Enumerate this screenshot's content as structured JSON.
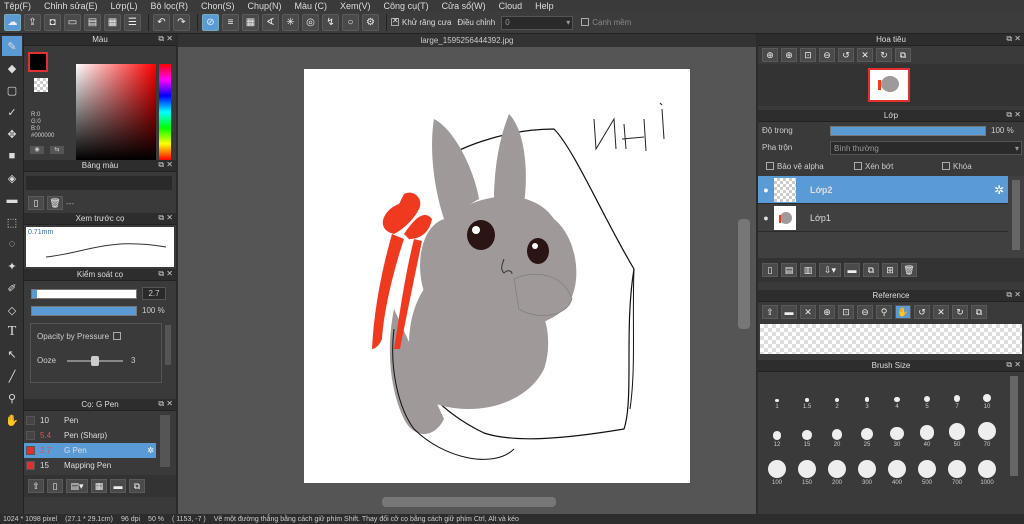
{
  "menu": [
    "Tệp(F)",
    "Chỉnh sửa(E)",
    "Lớp(L)",
    "Bộ lọc(R)",
    "Chọn(S)",
    "Chụp(N)",
    "Màu (C)",
    "Xem(V)",
    "Công cụ(T)",
    "Cửa sổ(W)",
    "Cloud",
    "Help"
  ],
  "toolbar": {
    "antialias_label": "Khử răng cưa",
    "adjust_label": "Điều chỉnh",
    "adjust_value": "0",
    "smooth_label": "Cạnh mềm"
  },
  "color_panel": {
    "title": "Màu",
    "r": "R:0",
    "g": "G:0",
    "b": "B:0",
    "hex": "#000000"
  },
  "palette_panel": {
    "title": "Bảng màu",
    "dash": "---"
  },
  "preview_panel": {
    "title": "Xem trước cọ",
    "size": "0.71mm"
  },
  "control_panel": {
    "title": "Kiểm soát cọ",
    "size_value": "2.7",
    "size_fraction": 0.05,
    "opacity_value": "100 %",
    "opacity_fraction": 1.0,
    "opacity_pressure": "Opacity by Pressure",
    "ooze_label": "Ooze",
    "ooze_value": "3",
    "ooze_fraction": 0.5
  },
  "brush_panel": {
    "title": "Cọ: G Pen",
    "items": [
      {
        "size": "10",
        "name": "Pen",
        "color": "#444444",
        "active": false
      },
      {
        "size": "5.4",
        "name": "Pen (Sharp)",
        "color": "#444444",
        "active": false
      },
      {
        "size": "2.7",
        "name": "G Pen",
        "color": "#e03030",
        "active": true
      },
      {
        "size": "15",
        "name": "Mapping Pen",
        "color": "#e03030",
        "active": false
      }
    ]
  },
  "document": {
    "tab": "large_1595256444392.jpg",
    "text_on_canvas": "NHi"
  },
  "navigator": {
    "title": "Hoa tiêu"
  },
  "layer_panel": {
    "title": "Lớp",
    "opacity_label": "Độ trong",
    "opacity_value": "100 %",
    "opacity_fraction": 1.0,
    "blend_label": "Pha trộn",
    "blend_value": "Bình thường",
    "protect_alpha": "Bảo vệ alpha",
    "clipping": "Xén bớt",
    "lock": "Khóa",
    "layers": [
      {
        "name": "Lớp2",
        "active": true
      },
      {
        "name": "Lớp1",
        "active": false
      }
    ]
  },
  "reference_panel": {
    "title": "Reference"
  },
  "brush_size_panel": {
    "title": "Brush Size",
    "sizes": [
      "1",
      "1.5",
      "2",
      "3",
      "4",
      "5",
      "7",
      "10",
      "12",
      "15",
      "20",
      "25",
      "30",
      "40",
      "50",
      "70",
      "100",
      "150",
      "200",
      "300",
      "400",
      "500",
      "700",
      "1000"
    ]
  },
  "status": {
    "dimensions": "1024 * 1098 pixel",
    "physical": "(27.1 * 29.1cm)",
    "dpi": "96 dpi",
    "zoom": "50 %",
    "coords": "( 1153, -7 )",
    "hint": "Vẽ một đường thẳng bằng cách giữ phím Shift. Thay đổi cỡ cọ bằng cách giữ phím Ctrl, Alt và kéo"
  },
  "colors": {
    "accent": "#5b9bd5",
    "ribbon": "#f03a20",
    "bunny": "#a09999"
  }
}
